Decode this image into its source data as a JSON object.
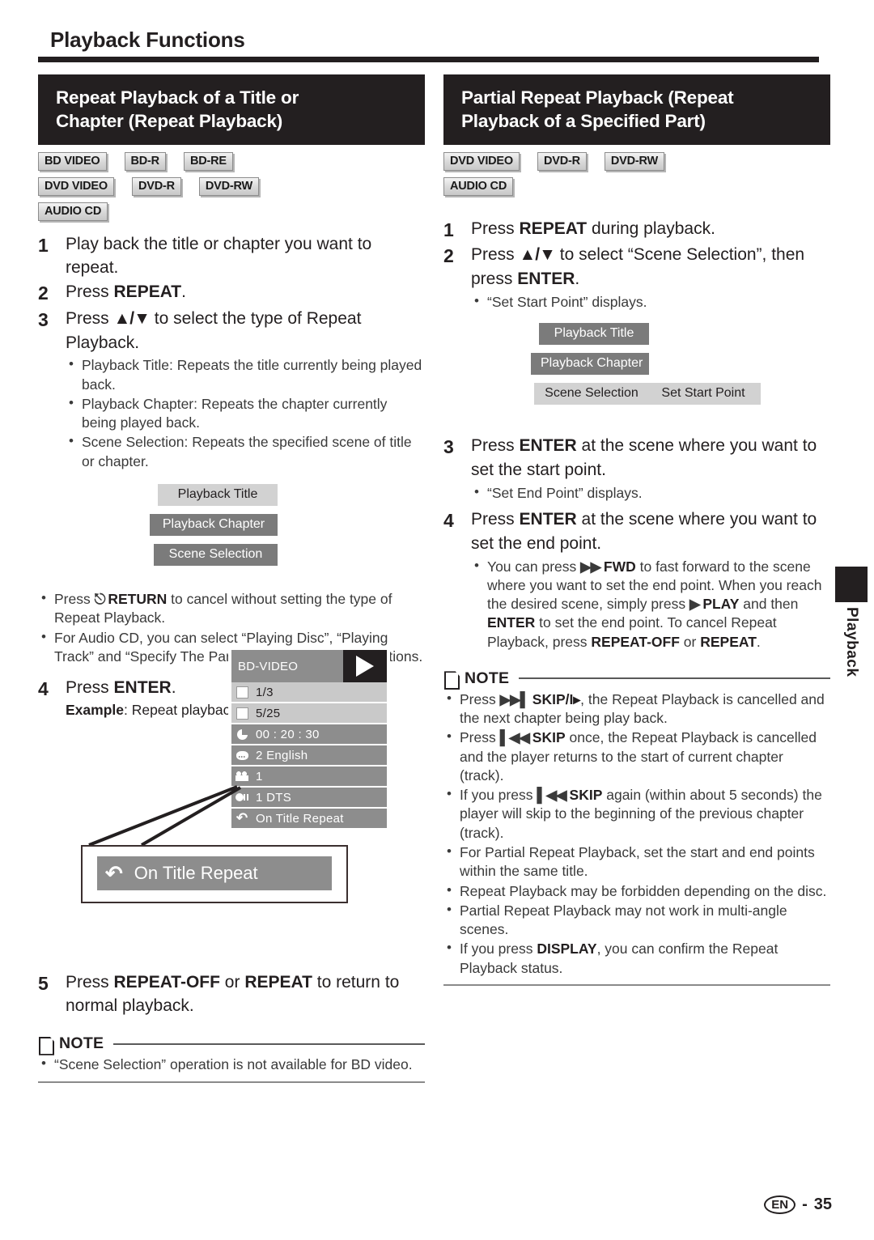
{
  "page": {
    "running_head": "Playback Functions",
    "footer_lang": "EN",
    "footer_sep": "-",
    "footer_page": "35",
    "side_tab_label": "Playback"
  },
  "left": {
    "title_line1": "Repeat Playback of a Title or",
    "title_line2": "Chapter (Repeat Playback)",
    "badges": [
      [
        "BD VIDEO",
        "BD-R",
        "BD-RE"
      ],
      [
        "DVD VIDEO",
        "DVD-R",
        "DVD-RW"
      ],
      [
        "AUDIO CD"
      ]
    ],
    "steps": [
      {
        "num": "1",
        "text": "Play back the title or chapter you want to repeat."
      },
      {
        "num": "2",
        "text_a": "Press ",
        "bold": "REPEAT",
        "text_b": "."
      },
      {
        "num": "3",
        "text_a": "Press ",
        "keys": "▲/▼",
        "text_b": " to select the type of Repeat Playback."
      }
    ],
    "step3_bullets": [
      "Playback Title: Repeats the title currently being played back.",
      "Playback Chapter: Repeats the chapter currently being played back.",
      "Scene Selection: Repeats the specified scene of title or chapter."
    ],
    "chips": [
      {
        "label": "Playback Title",
        "style": "light"
      },
      {
        "label": "Playback Chapter",
        "style": "dark"
      },
      {
        "label": "Scene Selection",
        "style": "dark"
      }
    ],
    "after_chips_bullets": [
      {
        "pre": "Press ",
        "icon": "return-icon",
        "bold": "RETURN",
        "post": " to cancel without setting the type of Repeat Playback."
      },
      {
        "pre": "For Audio CD, you can select “Playing Disc”, “Playing Track” and “Specify The Part” as Repeat Playback options."
      }
    ],
    "step4": {
      "num": "4",
      "text_a": "Press ",
      "bold": "ENTER",
      "text_b": "."
    },
    "example_label": "Example",
    "example_text": ": Repeat playback of a title (TITLE)",
    "osd": {
      "disc_label": "BD-VIDEO",
      "rows": [
        {
          "icon": "title-square-icon",
          "value": "1/3",
          "style": "light"
        },
        {
          "icon": "chapter-square-icon",
          "value": "5/25",
          "style": "light"
        },
        {
          "icon": "time-clock-icon",
          "value": "00 : 20 : 30",
          "style": "mid"
        },
        {
          "icon": "subtitle-icon",
          "value": "2 English",
          "style": "mid"
        },
        {
          "icon": "angle-camera-icon",
          "value": "1",
          "style": "mid"
        },
        {
          "icon": "audio-icon",
          "value": "1 DTS",
          "style": "mid"
        },
        {
          "icon": "repeat-icon",
          "value": "On Title Repeat",
          "style": "mid"
        }
      ]
    },
    "callout_text": "On Title Repeat",
    "step5": {
      "num": "5",
      "text_a": "Press ",
      "bold_a": "REPEAT-OFF",
      "mid": " or ",
      "bold_b": "REPEAT",
      "text_b": " to return to normal playback."
    },
    "note_title": "NOTE",
    "note_bullets": [
      "“Scene Selection” operation is not available for BD video."
    ]
  },
  "right": {
    "title_line1": "Partial Repeat Playback (Repeat",
    "title_line2": "Playback of a Specified Part)",
    "badges": [
      [
        "DVD VIDEO",
        "DVD-R",
        "DVD-RW"
      ],
      [
        "AUDIO CD"
      ]
    ],
    "step1": {
      "num": "1",
      "text_a": "Press ",
      "bold": "REPEAT",
      "text_b": " during playback."
    },
    "step2": {
      "num": "2",
      "text_a": "Press ",
      "keys": "▲/▼",
      "text_b": " to select “Scene Selection”, then press ",
      "bold": "ENTER",
      "text_c": "."
    },
    "step2_bullets": [
      "“Set Start Point” displays."
    ],
    "chips": [
      {
        "label": "Playback Title",
        "style": "dark"
      },
      {
        "label": "Playback Chapter",
        "style": "dark"
      },
      {
        "label": "Scene Selection",
        "style": "light"
      },
      {
        "label": "Set Start Point",
        "style": "light"
      }
    ],
    "step3": {
      "num": "3",
      "text_a": "Press ",
      "bold": "ENTER",
      "text_b": " at the scene where you want to set the start point."
    },
    "step3_bullets": [
      "“Set End Point” displays."
    ],
    "step4": {
      "num": "4",
      "text_a": "Press ",
      "bold": "ENTER",
      "text_b": " at the scene where you want to set the end point."
    },
    "step4_bullet": {
      "p1": "You can press ",
      "fwd_icon": "fast-forward-icon",
      "b1": "FWD",
      "p2": " to fast forward to the scene where you want to set the end point. When you reach the desired scene, simply press ",
      "play_icon": "play-icon",
      "b2": "PLAY",
      "p3": " and then ",
      "b3": "ENTER",
      "p4": " to set the end point. To cancel Repeat Playback, press ",
      "b4": "REPEAT-OFF",
      "p5": " or ",
      "b5": "REPEAT",
      "p6": "."
    },
    "note_title": "NOTE",
    "note_bullets": [
      {
        "p1": "Press ",
        "icon": "skip-forward-icon",
        "b1": "SKIP/I▸",
        "p2": ", the Repeat Playback is cancelled and the next chapter being play back."
      },
      {
        "p1": "Press ",
        "icon": "skip-back-icon",
        "b1": "SKIP",
        "p2": " once, the Repeat Playback is cancelled and the player returns to the start of current chapter (track)."
      },
      {
        "p1": "If you press ",
        "icon": "skip-back-icon",
        "b1": "SKIP",
        "p2": " again (within about 5 seconds) the player will skip to the beginning of the previous chapter (track)."
      },
      {
        "p1": "For Partial Repeat Playback, set the start and end points within the same title."
      },
      {
        "p1": "Repeat Playback may be forbidden depending on the disc."
      },
      {
        "p1": "Partial Repeat Playback may not work in multi-angle scenes."
      },
      {
        "p1": "If you press ",
        "b1": "DISPLAY",
        "p2": ", you can confirm the Repeat Playback status."
      }
    ]
  }
}
